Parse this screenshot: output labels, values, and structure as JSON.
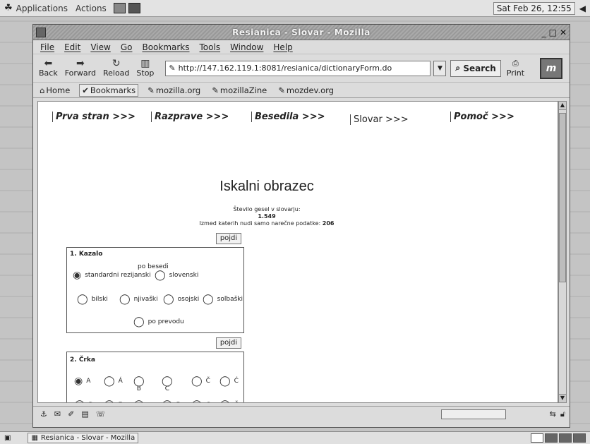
{
  "top_panel": {
    "menus": [
      "Applications",
      "Actions"
    ],
    "clock": "Sat Feb 26, 12:55"
  },
  "window": {
    "title": "Resianica - Slovar - Mozilla",
    "menu": [
      "File",
      "Edit",
      "View",
      "Go",
      "Bookmarks",
      "Tools",
      "Window",
      "Help"
    ],
    "nav_buttons": [
      "Back",
      "Forward",
      "Reload",
      "Stop"
    ],
    "url": "http://147.162.119.1:8081/resianica/dictionaryForm.do",
    "search_label": "Search",
    "print_label": "Print",
    "bookmarks": [
      "Home",
      "Bookmarks",
      "mozilla.org",
      "mozillaZine",
      "mozdev.org"
    ]
  },
  "page": {
    "site_nav": [
      "Prva stran >>>",
      "Razprave >>>",
      "Besedila >>>",
      "Slovar >>>",
      "Pomoč >>>"
    ],
    "title": "Iskalni obrazec",
    "stats_line1": "Število gesel v slovarju:",
    "stats_count": "1.549",
    "stats_line3_prefix": "Izmed katerih nudi samo narečne podatke: ",
    "stats_dialect": "206",
    "submit_label": "pojdi",
    "section1": {
      "legend": "1. Kazalo",
      "subheading": "po besedi",
      "options_row1": [
        "standardni rezijanski",
        "slovenski"
      ],
      "options_row2": [
        "bilski",
        "njivaški",
        "osojski",
        "solbaški"
      ],
      "option_row3": "po prevodu"
    },
    "section2": {
      "legend": "2. Črka",
      "letters_row1": [
        "A",
        "Á",
        "B",
        "C",
        "Č",
        "Ć"
      ],
      "letters_row2": [
        "D",
        "E",
        "Ė",
        "F",
        "G",
        "Ğ"
      ]
    }
  },
  "taskbar": {
    "task": "Resianica - Slovar - Mozilla"
  }
}
